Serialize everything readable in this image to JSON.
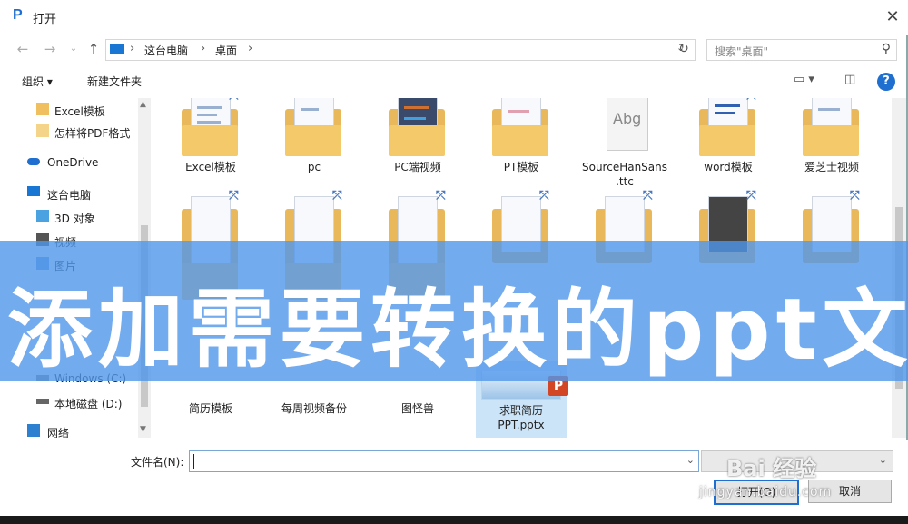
{
  "window": {
    "title": "打开",
    "app_icon_glyph": "P"
  },
  "nav": {
    "breadcrumb": [
      "这台电脑",
      "桌面"
    ],
    "search_placeholder": "搜索\"桌面\""
  },
  "toolbar": {
    "organize": "组织",
    "new_folder": "新建文件夹"
  },
  "sidebar": {
    "items": [
      {
        "label": "Excel模板",
        "icon": "folder-icon"
      },
      {
        "label": "怎样将PDF格式",
        "icon": "document-icon"
      },
      {
        "label": "OneDrive",
        "icon": "cloud-icon"
      },
      {
        "label": "这台电脑",
        "icon": "computer-icon"
      },
      {
        "label": "3D 对象",
        "icon": "cube-icon"
      },
      {
        "label": "视频",
        "icon": "video-icon"
      },
      {
        "label": "图片",
        "icon": "picture-icon"
      },
      {
        "label": "Windows (C:)",
        "icon": "drive-icon"
      },
      {
        "label": "本地磁盘 (D:)",
        "icon": "drive-icon"
      },
      {
        "label": "网络",
        "icon": "network-icon"
      }
    ]
  },
  "files": {
    "row1": [
      "Excel模板",
      "pc",
      "PC端视频",
      "PT模板",
      "SourceHanSans .ttc",
      "word模板",
      "爱芝士视频"
    ],
    "row2": [
      "简历模板",
      "每周视频备份",
      "图怪兽",
      "求职简历 PPT.pptx"
    ]
  },
  "banner": {
    "text": "添加需要转换的ppt文"
  },
  "bottom": {
    "filename_label": "文件名(N):",
    "open_button": "打开(O)",
    "cancel_button": "取消"
  },
  "watermark": {
    "main": "Bai 经验",
    "sub": "jingyan.baidu.com"
  },
  "colors": {
    "accent": "#1f6fd0",
    "banner": "#5096eb",
    "folder": "#e9b85a"
  }
}
